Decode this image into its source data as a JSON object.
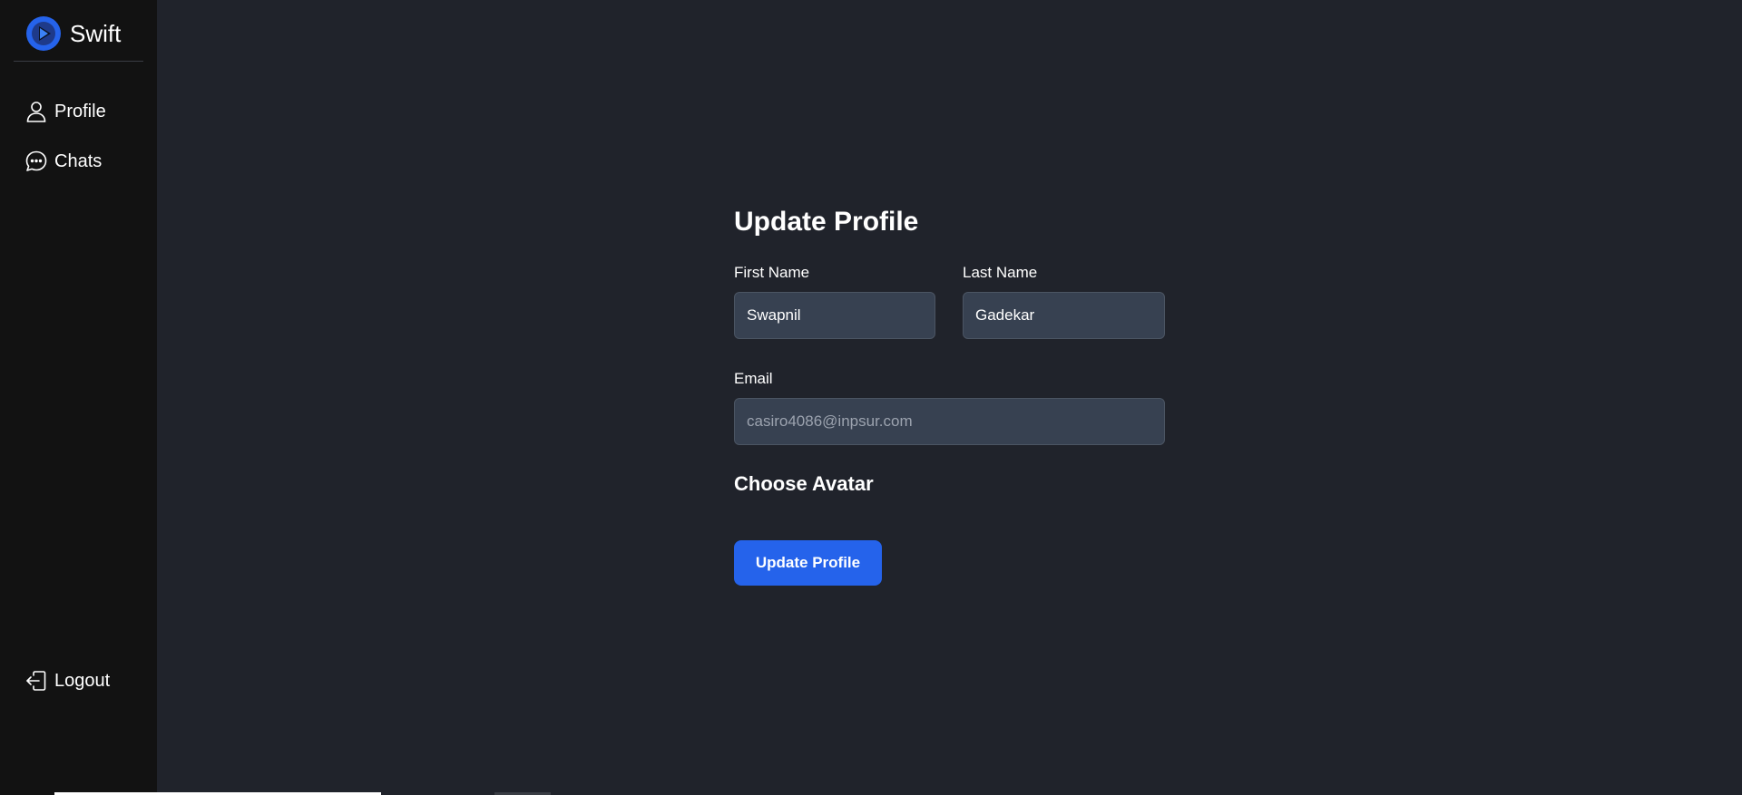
{
  "app": {
    "name": "Swift",
    "logo_icon": "play-logo-icon",
    "accent_color": "#2563eb"
  },
  "sidebar": {
    "items": [
      {
        "label": "Profile",
        "icon": "user-icon"
      },
      {
        "label": "Chats",
        "icon": "chat-bubble-icon"
      }
    ],
    "logout": {
      "label": "Logout",
      "icon": "logout-icon"
    }
  },
  "form": {
    "title": "Update Profile",
    "first_name": {
      "label": "First Name",
      "value": "Swapnil"
    },
    "last_name": {
      "label": "Last Name",
      "value": "Gadekar"
    },
    "email": {
      "label": "Email",
      "value": "casiro4086@inpsur.com"
    },
    "avatar_heading": "Choose Avatar",
    "submit_label": "Update Profile"
  }
}
